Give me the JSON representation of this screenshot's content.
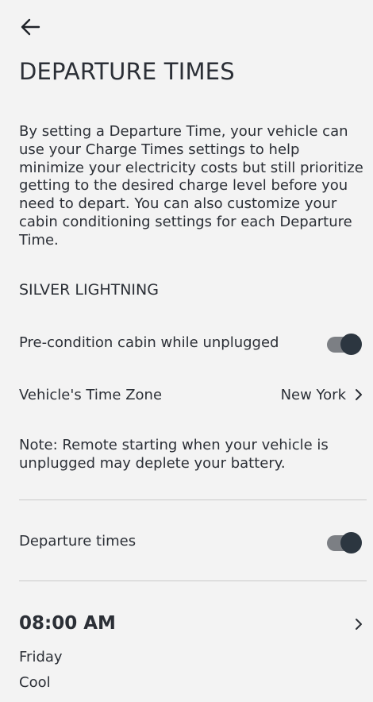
{
  "header": {
    "back_icon": "arrow-left-icon",
    "title": "DEPARTURE TIMES"
  },
  "description": "By setting a Departure Time, your vehicle can use your Charge Times settings to help minimize your electricity costs but still prioritize getting to the desired charge level before you need to depart. You can also customize your cabin conditioning settings for each Departure Time.",
  "vehicle": {
    "name": "SILVER LIGHTNING"
  },
  "precondition": {
    "label": "Pre-condition cabin while unplugged",
    "enabled": true
  },
  "time_zone": {
    "label": "Vehicle's Time Zone",
    "value": "New York",
    "chevron_icon": "chevron-right-icon"
  },
  "note": "Note: Remote starting when your vehicle is unplugged may deplete your battery.",
  "departure_times_toggle": {
    "label": "Departure times",
    "enabled": true
  },
  "departures": [
    {
      "time": "08:00 AM",
      "day": "Friday",
      "mode": "Cool"
    }
  ],
  "colors": {
    "background": "#f3f3f3",
    "text": "#2b2f36",
    "toggle_track": "#7c7f84",
    "toggle_thumb": "#2c3640",
    "divider": "#c9c9c9"
  }
}
